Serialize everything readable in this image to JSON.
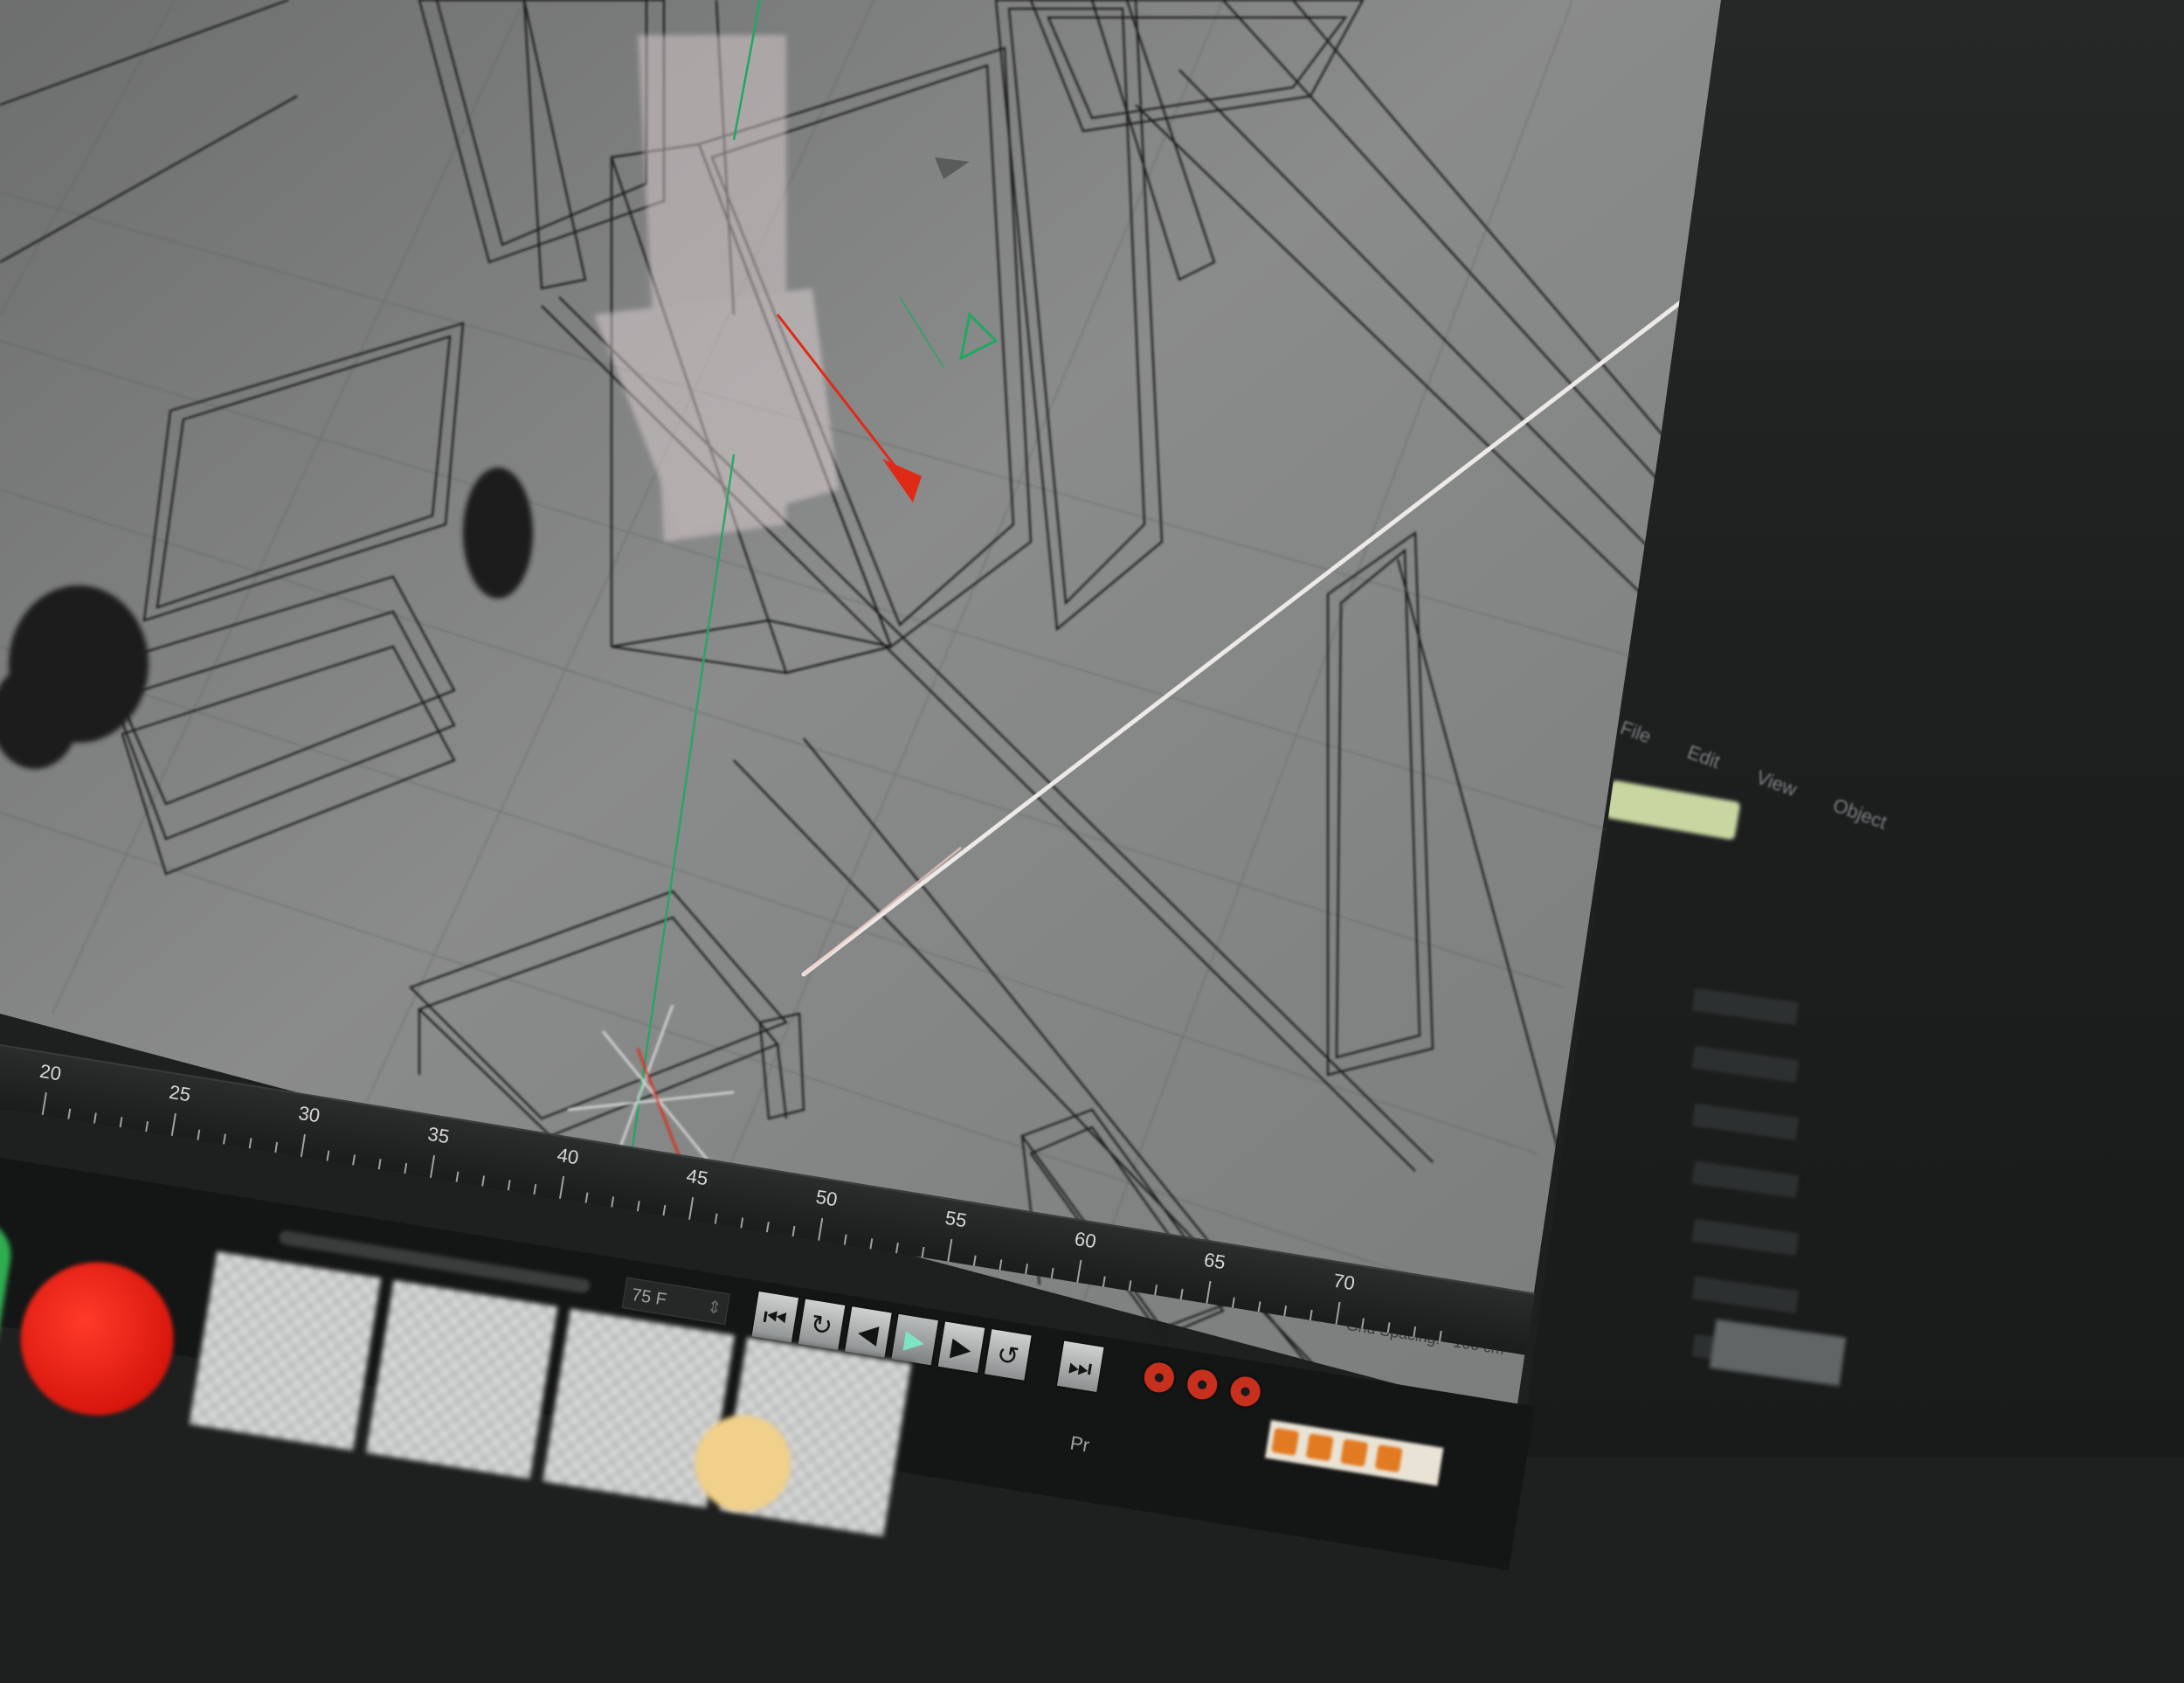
{
  "viewport": {
    "grid_spacing_label": "Grid Spacing:",
    "grid_spacing_value": "100 cm",
    "colors": {
      "background": "#7a7b7b",
      "wire": "#1c1d1d",
      "axis_y": "#1fa860",
      "axis_x": "#e02a18",
      "ray": "#ece9e6"
    }
  },
  "timeline": {
    "ticks": [
      "20",
      "25",
      "30",
      "35",
      "40",
      "45",
      "50",
      "55",
      "60",
      "65",
      "70"
    ]
  },
  "controls": {
    "current_frame": "75 F",
    "play_buttons": [
      {
        "label": "⏮",
        "icon": "go-to-start-icon"
      },
      {
        "label": "↻",
        "icon": "loop-back-icon"
      },
      {
        "label": "◀",
        "icon": "step-back-icon"
      },
      {
        "label": "▶",
        "icon": "play-icon"
      },
      {
        "label": "▶",
        "icon": "step-forward-icon"
      },
      {
        "label": "↺",
        "icon": "loop-forward-icon"
      },
      {
        "label": "⏭",
        "icon": "go-to-end-icon"
      }
    ],
    "record_buttons": [
      "⏺",
      "⏺",
      "⏺"
    ],
    "bottom_label": "Pr"
  },
  "shelf": {
    "thumb_count": 5,
    "accent_red": "#e0190f",
    "accent_green": "#2fae4f",
    "accent_yellow": "#f0d08a"
  },
  "attribute_panel": {
    "top_items": [
      "",
      "",
      "",
      "",
      "",
      "",
      "",
      "",
      "",
      "",
      "",
      "",
      ""
    ],
    "menu": [
      "File",
      "Edit",
      "View",
      "Object"
    ],
    "selected_tab_label": "",
    "node_name": "",
    "properties": [
      "",
      "",
      "",
      "",
      "",
      "",
      "",
      "",
      "",
      "",
      "",
      "",
      ""
    ],
    "accent_green": "#c8d7a2"
  }
}
